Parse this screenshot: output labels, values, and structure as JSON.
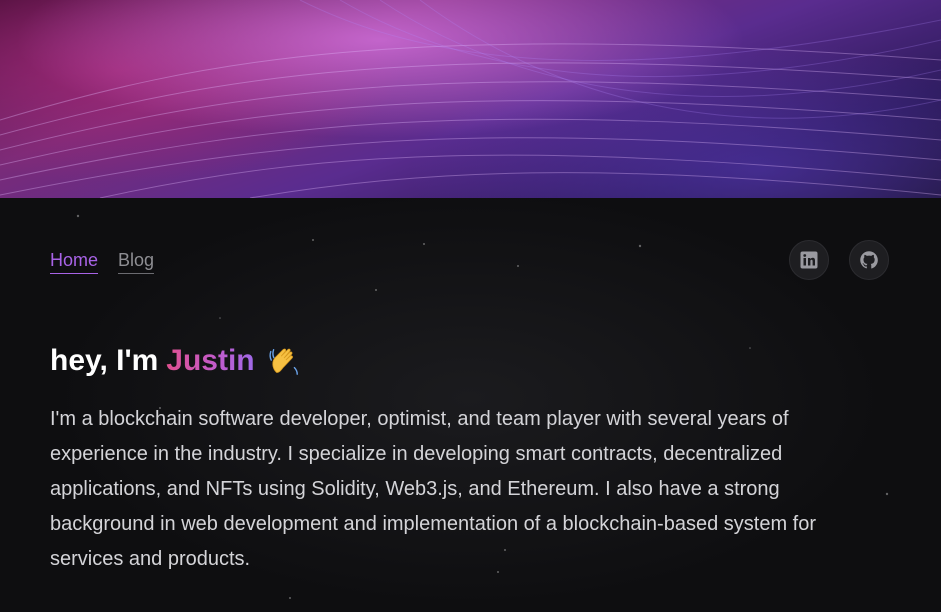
{
  "nav": {
    "items": [
      {
        "label": "Home",
        "active": true
      },
      {
        "label": "Blog",
        "active": false
      }
    ]
  },
  "socials": [
    {
      "icon": "linkedin-icon"
    },
    {
      "icon": "github-icon"
    }
  ],
  "intro": {
    "greeting": "hey, I'm",
    "name": "Justin",
    "emoji": "waving-hand-icon"
  },
  "bio": "I'm a blockchain software developer, optimist, and team player with several years of experience in the industry. I specialize in developing smart contracts, decentralized applications, and NFTs using Solidity, Web3.js, and Ethereum. I also have a strong background in web development and implementation of a blockchain-based system for services and products.",
  "colors": {
    "accent": "#a863e6",
    "name_gradient_start": "#e0508f",
    "name_gradient_end": "#9f6ae8",
    "background": "#0e0e10"
  }
}
